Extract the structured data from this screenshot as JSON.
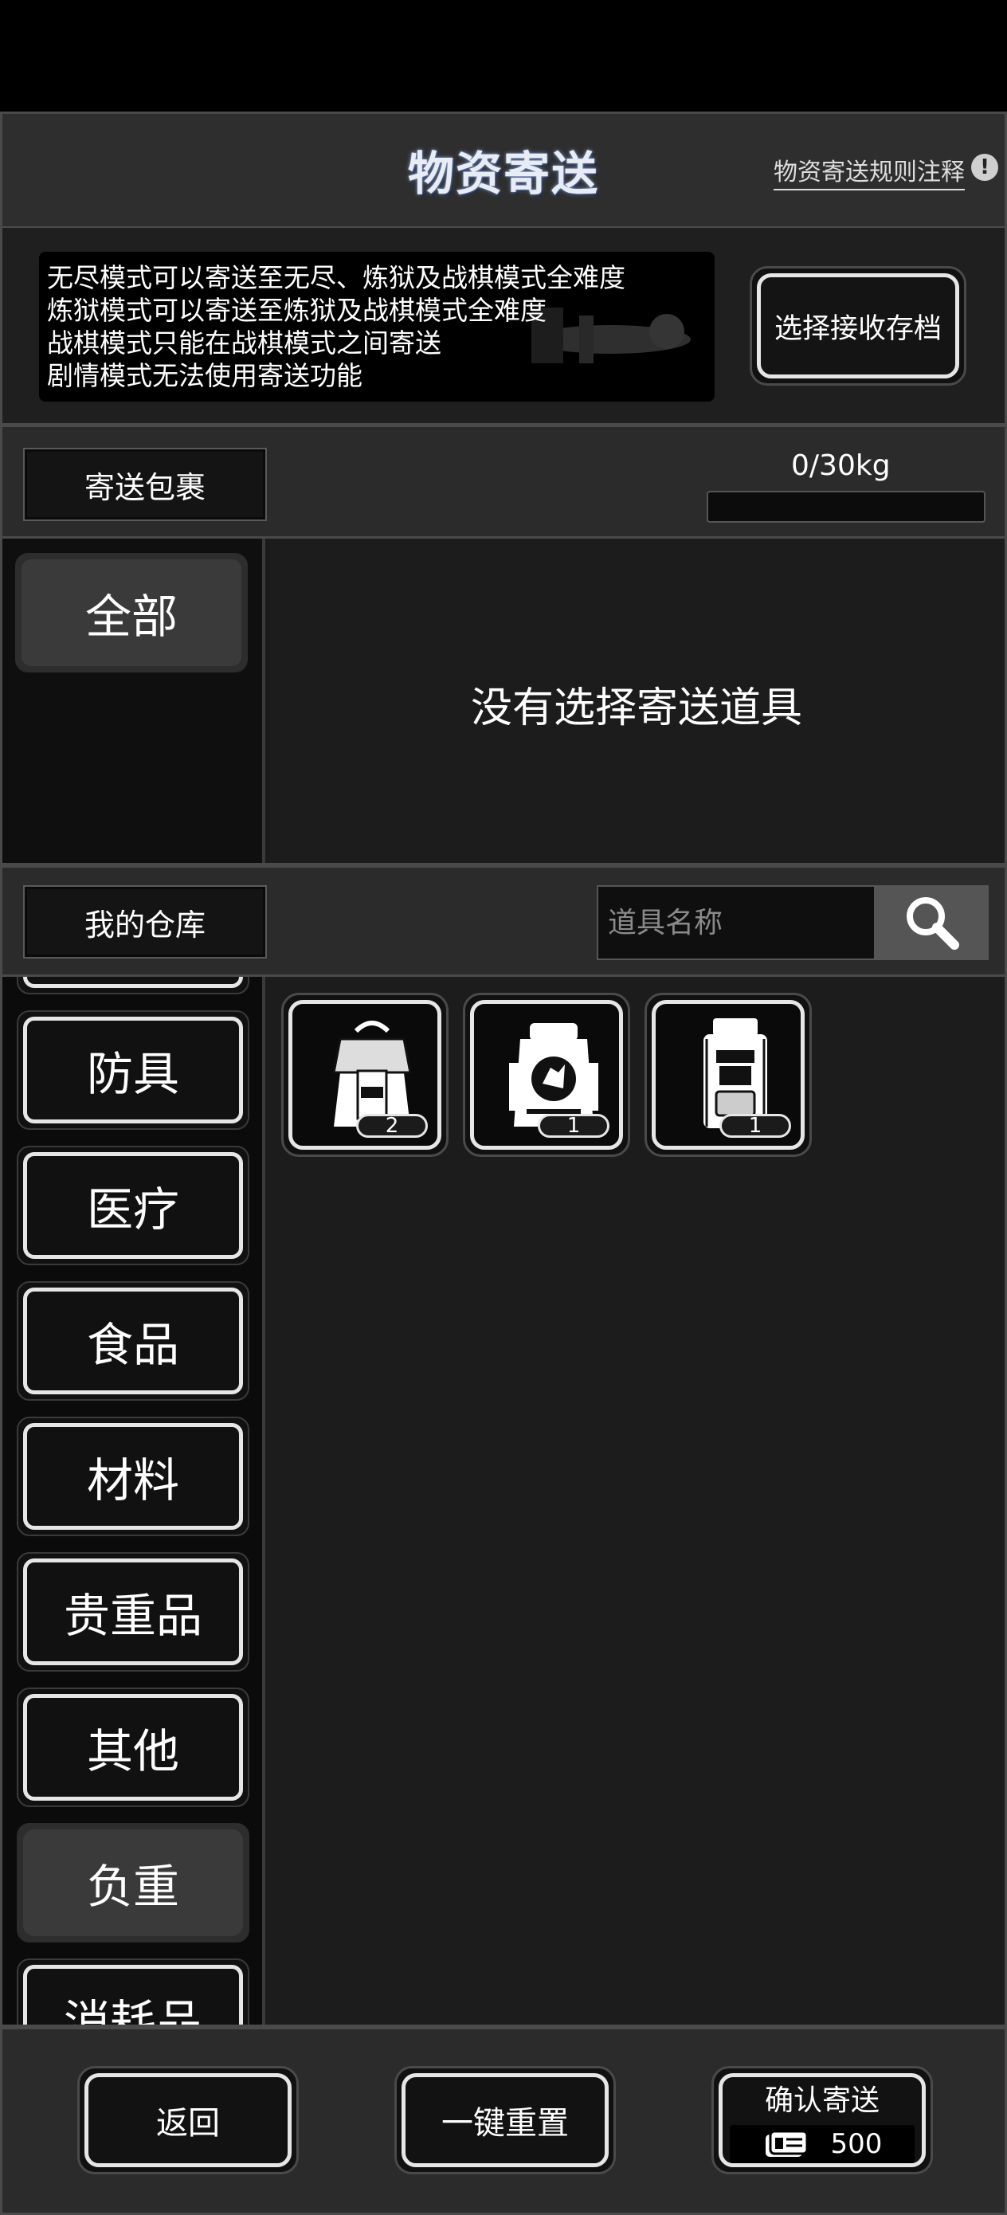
{
  "header": {
    "title": "物资寄送",
    "rules_link": "物资寄送规则注释"
  },
  "info": {
    "lines": [
      "无尽模式可以寄送至无尽、炼狱及战棋模式全难度",
      "炼狱模式可以寄送至炼狱及战棋模式全难度",
      "战棋模式只能在战棋模式之间寄送",
      "剧情模式无法使用寄送功能"
    ],
    "select_save_button": "选择接收存档"
  },
  "parcel": {
    "tag": "寄送包裹",
    "weight_text": "0/30kg",
    "weight_fraction": 0
  },
  "selected": {
    "active_category": "全部",
    "empty_message": "没有选择寄送道具"
  },
  "warehouse": {
    "tag": "我的仓库",
    "search_placeholder": "道具名称",
    "categories": [
      "防具",
      "医疗",
      "食品",
      "材料",
      "贵重品",
      "其他",
      "负重",
      "消耗品"
    ],
    "active_category": "负重",
    "items": [
      {
        "icon": "backpack-small-icon",
        "quantity": "2"
      },
      {
        "icon": "backpack-tactical-icon",
        "quantity": "1"
      },
      {
        "icon": "backpack-large-icon",
        "quantity": "1"
      }
    ]
  },
  "footer": {
    "back_button": "返回",
    "reset_button": "一键重置",
    "confirm_button": "确认寄送",
    "cost_icon": "ticket-icon",
    "cost": "500"
  }
}
